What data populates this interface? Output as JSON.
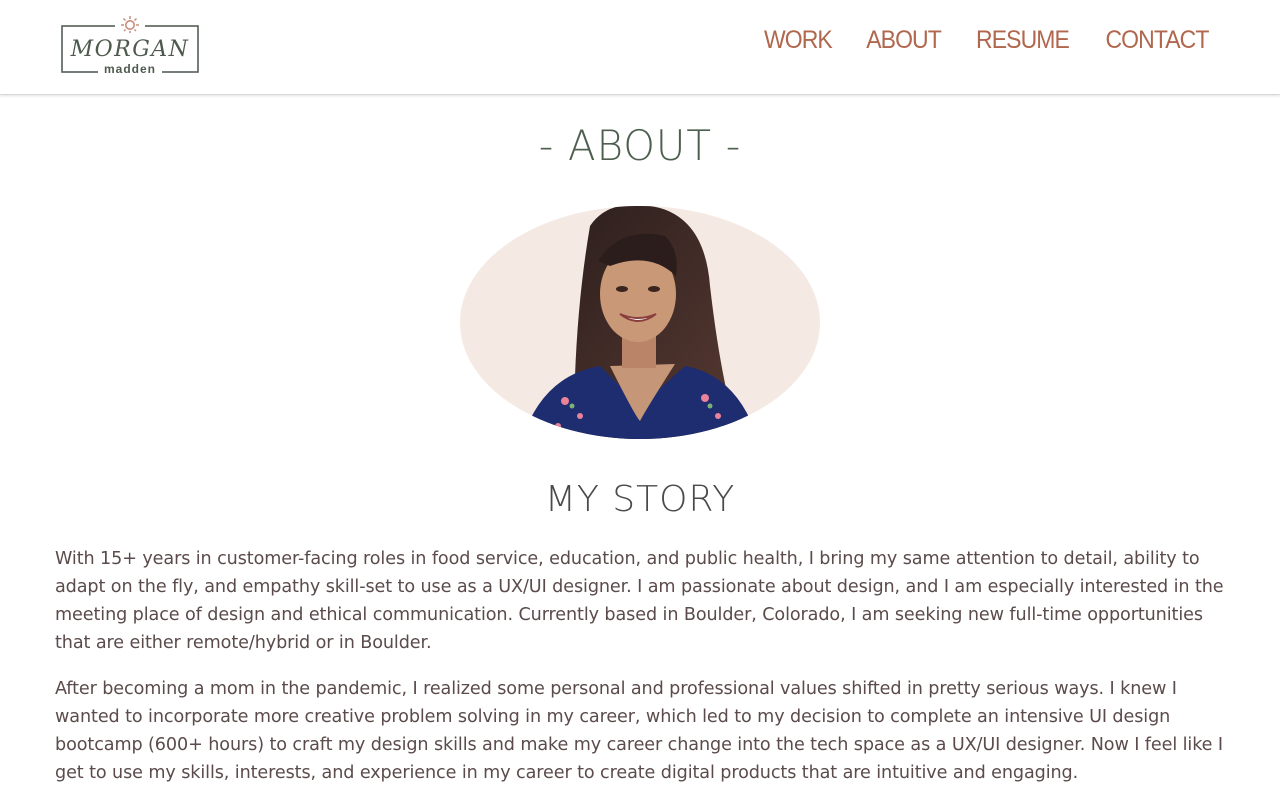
{
  "header": {
    "logo": {
      "name_top": "MORGAN",
      "name_bottom": "madden"
    },
    "nav": [
      {
        "label": "WORK"
      },
      {
        "label": "ABOUT"
      },
      {
        "label": "RESUME"
      },
      {
        "label": "CONTACT"
      }
    ]
  },
  "main": {
    "page_title": "- ABOUT -",
    "section_title": "MY STORY",
    "paragraphs": [
      "With 15+ years in customer-facing roles in food service, education, and public health, I bring my same attention to detail, ability to adapt on the fly, and empathy skill-set to use as a UX/UI designer. I am passionate about design, and I am especially interested in the meeting place of design and ethical communication. Currently based in Boulder, Colorado, I am seeking new full-time opportunities that are either remote/hybrid or in Boulder.",
      "After becoming a mom in the pandemic, I realized some personal and professional values shifted in pretty serious ways. I knew I wanted to incorporate more creative problem solving in my career, which led to my decision to complete an intensive UI design bootcamp (600+ hours) to craft my design skills and make my career change into the tech space as a UX/UI designer. Now I feel like I get to use my skills, interests, and experience in my career to create digital products that are intuitive and engaging."
    ]
  },
  "colors": {
    "nav_accent": "#b0674d",
    "title_green": "#4f5f4f",
    "body_text": "#5b4b4b",
    "portrait_bg": "#f5e9e4"
  }
}
